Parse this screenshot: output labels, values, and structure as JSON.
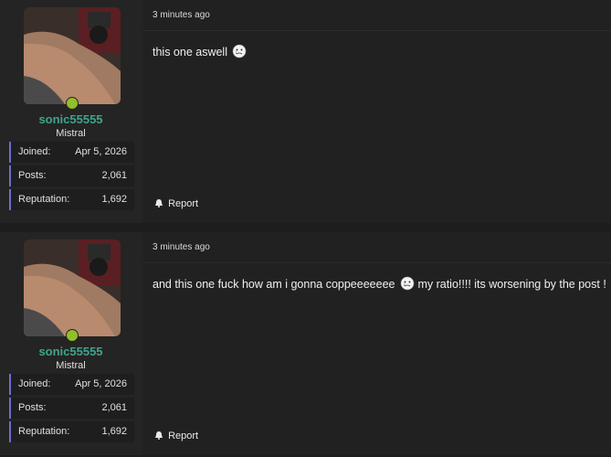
{
  "posts": [
    {
      "timestamp": "3 minutes ago",
      "user": {
        "name": "sonic55555",
        "title": "Mistral",
        "online": true
      },
      "stats": [
        {
          "label": "Joined:",
          "value": "Apr 5, 2026"
        },
        {
          "label": "Posts:",
          "value": "2,061"
        },
        {
          "label": "Reputation:",
          "value": "1,692"
        }
      ],
      "message": {
        "text": "this one aswell",
        "emoji": "crying-face-icon",
        "text_after": ""
      },
      "report_label": "Report"
    },
    {
      "timestamp": "3 minutes ago",
      "user": {
        "name": "sonic55555",
        "title": "Mistral",
        "online": true
      },
      "stats": [
        {
          "label": "Joined:",
          "value": "Apr 5, 2026"
        },
        {
          "label": "Posts:",
          "value": "2,061"
        },
        {
          "label": "Reputation:",
          "value": "1,692"
        }
      ],
      "message": {
        "text": "and this one fuck how am i gonna coppeeeeeee",
        "emoji": "crying-face-icon",
        "text_after": "my ratio!!!! its worsening by the post !"
      },
      "report_label": "Report"
    }
  ],
  "colors": {
    "username": "#3fa58b",
    "online": "#8fbf2b",
    "stat_accent": "#6d6fcf",
    "background": "#1d1d1d"
  }
}
